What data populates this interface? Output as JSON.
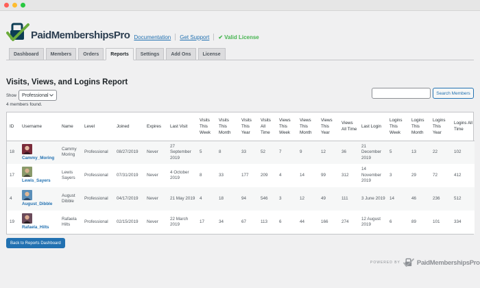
{
  "brand": {
    "name_part1": "Paid",
    "name_part2": "Memberships",
    "name_part3": "Pro",
    "doc_link": "Documentation",
    "support_link": "Get Support",
    "license": "Valid License"
  },
  "tabs": [
    {
      "label": "Dashboard",
      "active": false
    },
    {
      "label": "Members",
      "active": false
    },
    {
      "label": "Orders",
      "active": false
    },
    {
      "label": "Reports",
      "active": true
    },
    {
      "label": "Settings",
      "active": false
    },
    {
      "label": "Add Ons",
      "active": false
    },
    {
      "label": "License",
      "active": false
    }
  ],
  "page": {
    "title": "Visits, Views, and Logins Report",
    "show_label": "Show",
    "show_value": "Professional",
    "found": "4 members found.",
    "search_button": "Search Members",
    "search_value": ""
  },
  "table": {
    "headers": [
      "ID",
      "Username",
      "Name",
      "Level",
      "Joined",
      "Expires",
      "Last Visit",
      "Visits This Week",
      "Visits This Month",
      "Visits This Year",
      "Visits All Time",
      "Views This Week",
      "Views This Month",
      "Views This Year",
      "Views All Time",
      "Last Login",
      "Logins This Week",
      "Logins This Month",
      "Logins This Year",
      "Logins All Time"
    ],
    "rows": [
      [
        "18",
        "Cammy_Moring",
        "Cammy Moring",
        "Professional",
        "08/27/2019",
        "Never",
        "27 September 2019",
        "5",
        "8",
        "33",
        "52",
        "7",
        "9",
        "12",
        "36",
        "21 December 2019",
        "5",
        "13",
        "22",
        "102"
      ],
      [
        "17",
        "Lewis_Sayers",
        "Lewis Sayers",
        "Professional",
        "07/31/2019",
        "Never",
        "4 October 2019",
        "8",
        "33",
        "177",
        "209",
        "4",
        "14",
        "99",
        "312",
        "14 November 2019",
        "3",
        "29",
        "72",
        "412"
      ],
      [
        "4",
        "August_Dibble",
        "August Dibble",
        "Professional",
        "04/17/2019",
        "Never",
        "21 May 2019",
        "4",
        "18",
        "94",
        "546",
        "3",
        "12",
        "49",
        "111",
        "3 June 2019",
        "14",
        "46",
        "236",
        "512"
      ],
      [
        "19",
        "Rafaela_Hilts",
        "Rafaela Hilts",
        "Professional",
        "02/15/2019",
        "Never",
        "22 March 2019",
        "17",
        "34",
        "67",
        "113",
        "6",
        "44",
        "166",
        "274",
        "12 August 2019",
        "6",
        "89",
        "101",
        "334"
      ]
    ]
  },
  "back_button": "Back to Reports Dashboard",
  "footer": {
    "powered_by": "POWERED BY",
    "logo_text": "PaidMembershipsPro"
  },
  "colors": {
    "accent": "#2271b1",
    "valid": "#46b450",
    "logo_green": "#6bab3b",
    "logo_blue": "#0c3d54"
  }
}
